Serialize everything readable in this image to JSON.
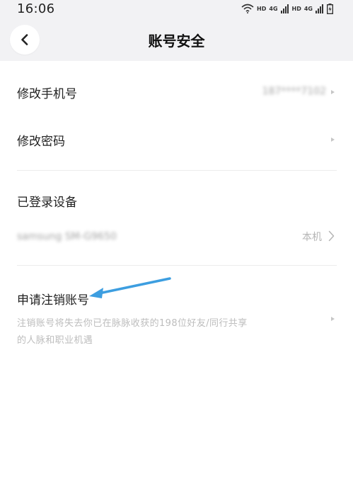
{
  "status_bar": {
    "time": "16:06",
    "network_label_1": "HD",
    "network_label_2": "HD",
    "signal_label": "4G"
  },
  "header": {
    "title": "账号安全",
    "back_icon": "chevron-left-icon"
  },
  "account": {
    "change_phone_label": "修改手机号",
    "phone_value": "187****7102",
    "change_password_label": "修改密码"
  },
  "devices": {
    "section_label": "已登录设备",
    "device_name": "samsung SM-G9650",
    "device_tag": "本机"
  },
  "deactivate": {
    "label": "申请注销账号",
    "description": "注销账号将失去你已在脉脉收获的198位好友/同行共享的人脉和职业机遇"
  },
  "annotation": {
    "arrow_color": "#3d9ee0"
  },
  "colors": {
    "header_bg": "#f2f2f4",
    "text_primary": "#222222",
    "text_secondary": "#bdbdbd"
  }
}
